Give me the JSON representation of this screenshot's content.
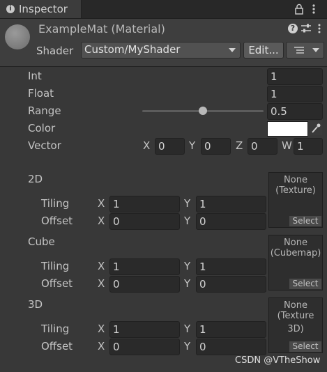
{
  "tab": {
    "title": "Inspector",
    "icon": "info-icon",
    "lock_icon": "lock-icon",
    "menu_icon": "kebab-menu-icon"
  },
  "header": {
    "title": "ExampleMat (Material)",
    "shader_label": "Shader",
    "shader_value": "Custom/MyShader",
    "edit_label": "Edit...",
    "icons": [
      "help-icon",
      "preset-icon",
      "context-menu-icon",
      "list-icon"
    ]
  },
  "properties": {
    "int": {
      "label": "Int",
      "value": "1"
    },
    "float": {
      "label": "Float",
      "value": "1"
    },
    "range": {
      "label": "Range",
      "value": "0.5",
      "fraction": 0.5
    },
    "color": {
      "label": "Color",
      "value_color": "#ffffff",
      "picker_icon": "eyedropper-icon"
    },
    "vector": {
      "label": "Vector",
      "axes": [
        "X",
        "Y",
        "Z",
        "W"
      ],
      "values": [
        "0",
        "0",
        "0",
        "1"
      ]
    }
  },
  "textures": [
    {
      "label": "2D",
      "slot_line1": "None",
      "slot_line2": "(Texture)",
      "select": "Select",
      "tiling_label": "Tiling",
      "offset_label": "Offset",
      "tiling_x": "1",
      "tiling_y": "1",
      "offset_x": "0",
      "offset_y": "0"
    },
    {
      "label": "Cube",
      "slot_line1": "None",
      "slot_line2": "(Cubemap)",
      "select": "Select",
      "tiling_label": "Tiling",
      "offset_label": "Offset",
      "tiling_x": "1",
      "tiling_y": "1",
      "offset_x": "0",
      "offset_y": "0"
    },
    {
      "label": "3D",
      "slot_line1": "None",
      "slot_line2": "(Texture 3D)",
      "select": "Select",
      "tiling_label": "Tiling",
      "offset_label": "Offset",
      "tiling_x": "1",
      "tiling_y": "1",
      "offset_x": "0",
      "offset_y": "0"
    }
  ],
  "axis_labels": {
    "x": "X",
    "y": "Y"
  },
  "watermark": "CSDN @VTheShow",
  "colors": {
    "background": "#383838",
    "field": "#2a2a2a",
    "tab_bar": "#282828"
  }
}
